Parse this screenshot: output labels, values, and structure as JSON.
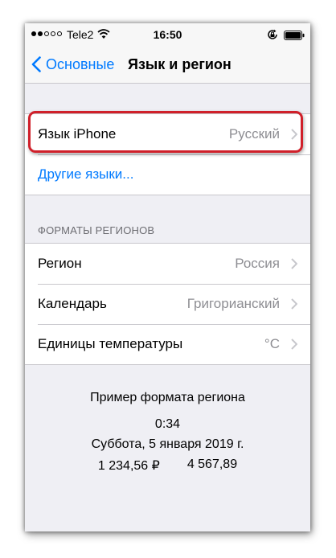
{
  "status_bar": {
    "carrier": "Tele2",
    "time": "16:50",
    "signal_bars_full": 2,
    "signal_bars_total": 5
  },
  "nav": {
    "back_label": "Основные",
    "title": "Язык и регион"
  },
  "language_group": {
    "iphone_language_label": "Язык iPhone",
    "iphone_language_value": "Русский",
    "other_languages_label": "Другие языки..."
  },
  "formats": {
    "header": "ФОРМАТЫ РЕГИОНОВ",
    "items": [
      {
        "label": "Регион",
        "value": "Россия"
      },
      {
        "label": "Календарь",
        "value": "Григорианский"
      },
      {
        "label": "Единицы температуры",
        "value": "°C"
      }
    ]
  },
  "example": {
    "title": "Пример формата региона",
    "time": "0:34",
    "date": "Суббота, 5 января 2019 г.",
    "amount1": "1 234,56 ₽",
    "amount2": "4 567,89"
  },
  "colors": {
    "accent": "#007aff",
    "highlight": "#d0202a",
    "background": "#efeff4"
  },
  "icons": [
    "wifi-icon",
    "rotation-lock-icon",
    "battery-icon",
    "chevron-left-icon",
    "chevron-right-icon"
  ]
}
